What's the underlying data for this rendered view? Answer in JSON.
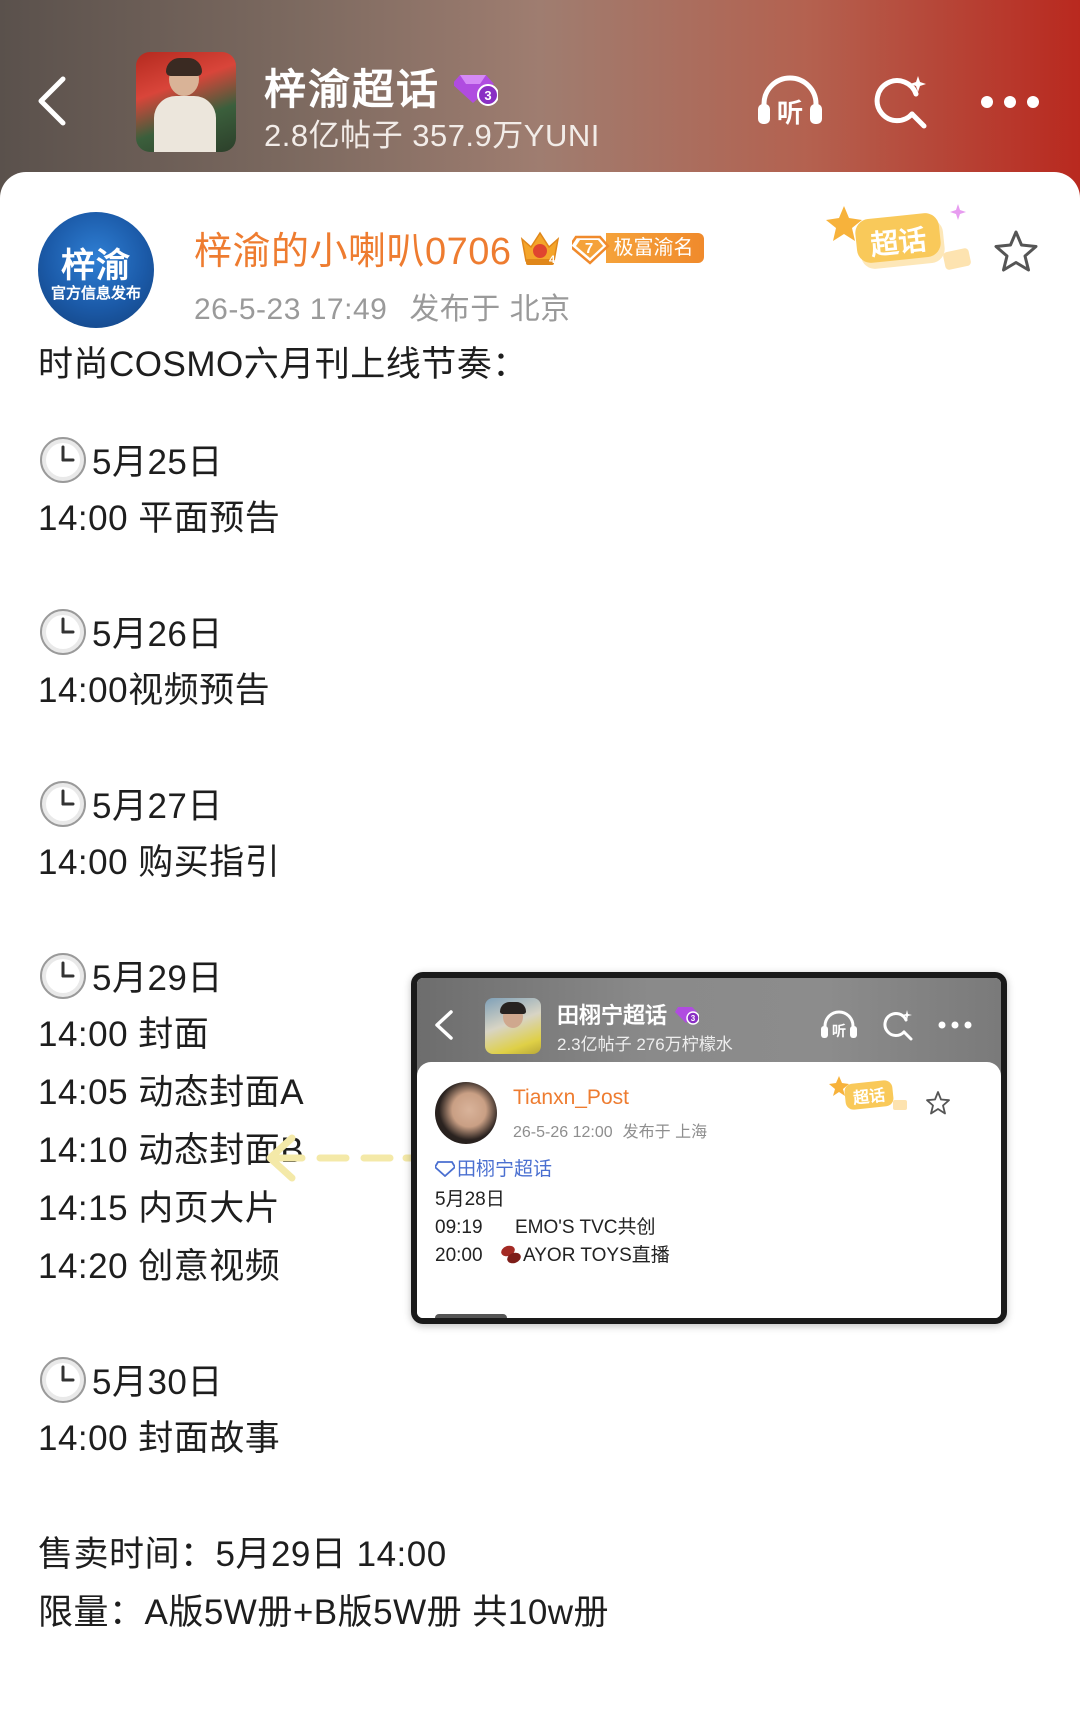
{
  "header": {
    "title": "梓渝超话",
    "subtitle": "2.8亿帖子 357.9万YUNI",
    "level": "3",
    "colors": {
      "gradient_start": "#5a514c",
      "gradient_end": "#b9291f"
    },
    "icons": [
      "back-icon",
      "listen-icon",
      "search-icon",
      "more-icon"
    ]
  },
  "post": {
    "author": {
      "avatar_text_main": "梓渝",
      "avatar_text_sub": "官方信息发布",
      "name": "梓渝的小喇叭0706",
      "crown_level": "4",
      "fan_badge_level": "7",
      "fan_badge_label": "极富渝名"
    },
    "time": "26-5-23 17:49",
    "location": "发布于 北京",
    "stamp_label": "超话",
    "intro": "时尚COSMO六月刊上线节奏：",
    "schedule": [
      {
        "date": "5月25日",
        "items": [
          "14:00 平面预告"
        ]
      },
      {
        "date": "5月26日",
        "items": [
          "14:00视频预告"
        ]
      },
      {
        "date": "5月27日",
        "items": [
          "14:00 购买指引"
        ]
      },
      {
        "date": "5月29日",
        "items": [
          "14:00 封面",
          "14:05 动态封面A",
          "14:10 动态封面B",
          "14:15 内页大片",
          "14:20 创意视频"
        ]
      },
      {
        "date": "5月30日",
        "items": [
          "14:00 封面故事"
        ]
      }
    ],
    "sale_time": "售卖时间：5月29日 14:00",
    "limit": "限量：A版5W册+B版5W册 共10w册"
  },
  "embed": {
    "header_title": "田栩宁超话",
    "header_level": "3",
    "header_subtitle": "2.3亿帖子 276万柠檬水",
    "author_name": "Tianxn_Post",
    "time": "26-5-26 12:00",
    "location": "发布于 上海",
    "stamp_label": "超话",
    "topic": "田栩宁超话",
    "lines": [
      {
        "time": "5月28日",
        "text": ""
      },
      {
        "time": "09:19",
        "text": "EMO'S TVC共创"
      },
      {
        "time": "20:00",
        "text": "AYOR TOYS直播"
      }
    ]
  }
}
